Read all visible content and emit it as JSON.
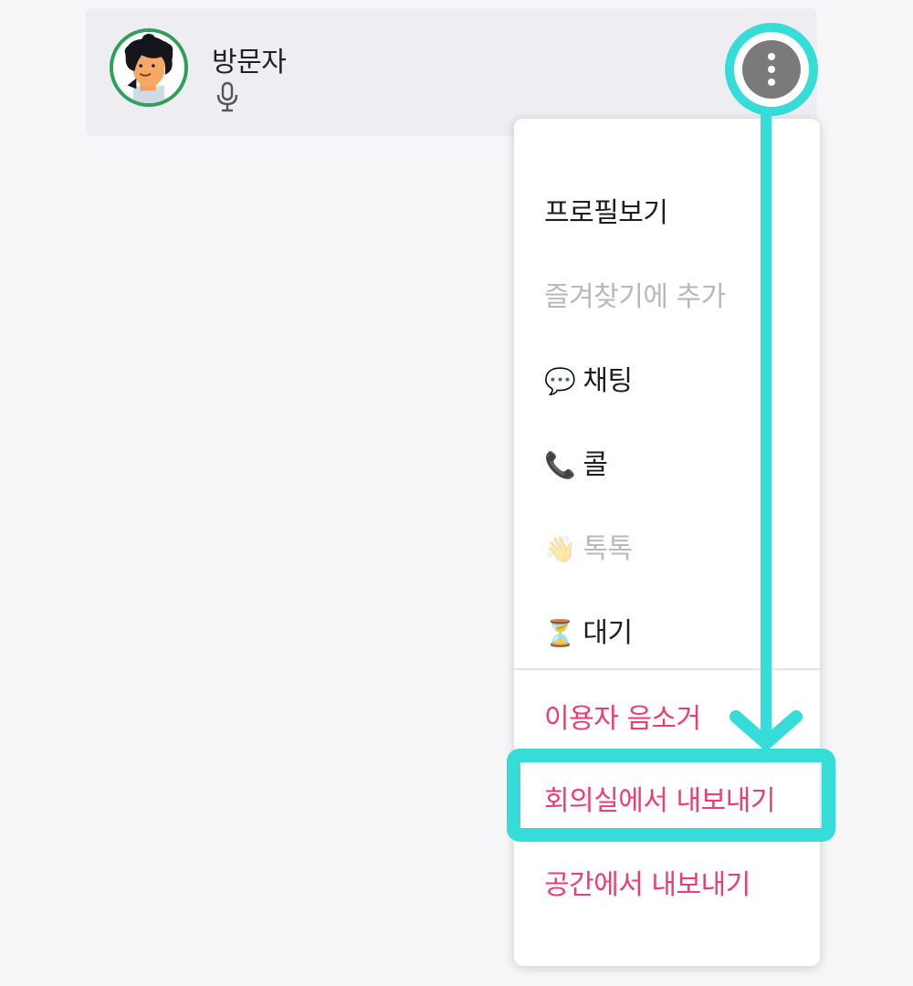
{
  "participant": {
    "name": "방문자",
    "avatar_icon": "cartoon-face-avatar",
    "status_icon": "microphone-icon"
  },
  "more_button": {
    "icon": "vertical-dots-icon"
  },
  "menu": {
    "items": [
      {
        "label": "프로필보기",
        "emoji": "",
        "state": "normal"
      },
      {
        "label": "즐겨찾기에 추가",
        "emoji": "",
        "state": "disabled"
      },
      {
        "label": "채팅",
        "emoji": "💬",
        "state": "normal"
      },
      {
        "label": "콜",
        "emoji": "📞",
        "state": "normal"
      },
      {
        "label": "톡톡",
        "emoji": "👋",
        "state": "disabled"
      },
      {
        "label": "대기",
        "emoji": "⏳",
        "state": "normal"
      }
    ],
    "danger_items": [
      {
        "label": "이용자 음소거"
      },
      {
        "label": "회의실에서 내보내기"
      },
      {
        "label": "공간에서 내보내기"
      }
    ]
  },
  "colors": {
    "highlight": "#35dcd8",
    "danger": "#ef3c73",
    "avatar_ring": "#2ea05a"
  }
}
